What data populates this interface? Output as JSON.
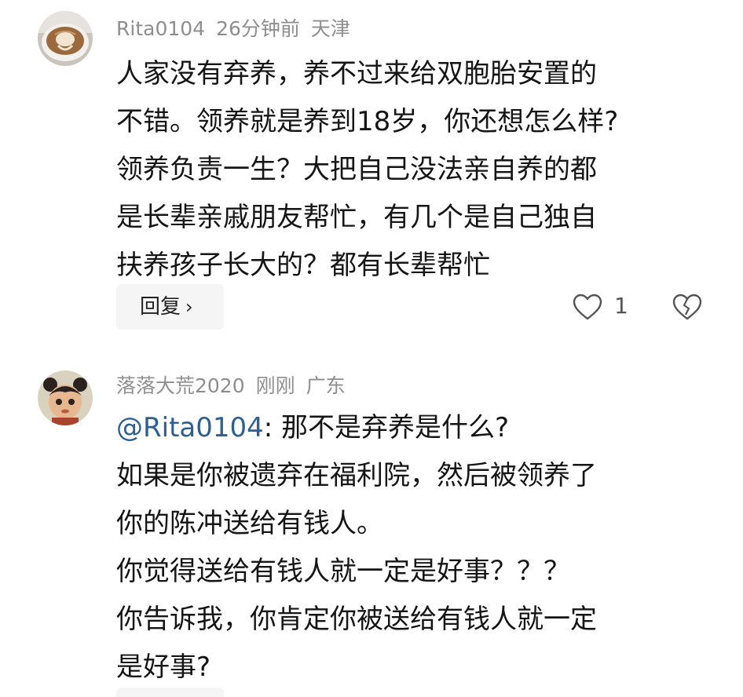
{
  "comments": [
    {
      "username": "Rita0104",
      "time": "26分钟前",
      "location": "天津",
      "avatar_icon": "latte-art-avatar",
      "lines": [
        "人家没有弃养，养不过来给双胞胎安置的",
        "不错。领养就是养到18岁，你还想怎么样?",
        "领养负责一生？大把自己没法亲自养的都",
        "是长辈亲戚朋友帮忙，有几个是自己独自",
        "扶养孩子长大的？都有长辈帮忙"
      ],
      "reply_label": "回复",
      "reply_chevron": "›",
      "like_count": "1",
      "like_icon": "heart-icon",
      "dislike_icon": "broken-heart-icon"
    },
    {
      "username": "落落大荒2020",
      "time": "刚刚",
      "location": "广东",
      "avatar_icon": "cartoon-girl-avatar",
      "mention": "@Rita0104",
      "first_line_rest": ": 那不是弃养是什么?",
      "lines": [
        "如果是你被遗弃在福利院，然后被领养了",
        "你的陈冲送给有钱人。",
        "你觉得送给有钱人就一定是好事？？？",
        "你告诉我，你肯定你被送给有钱人就一定",
        "是好事?"
      ]
    }
  ],
  "colors": {
    "meta": "#8e8e8e",
    "mention": "#2c5f93",
    "button_bg": "#f5f5f5"
  }
}
